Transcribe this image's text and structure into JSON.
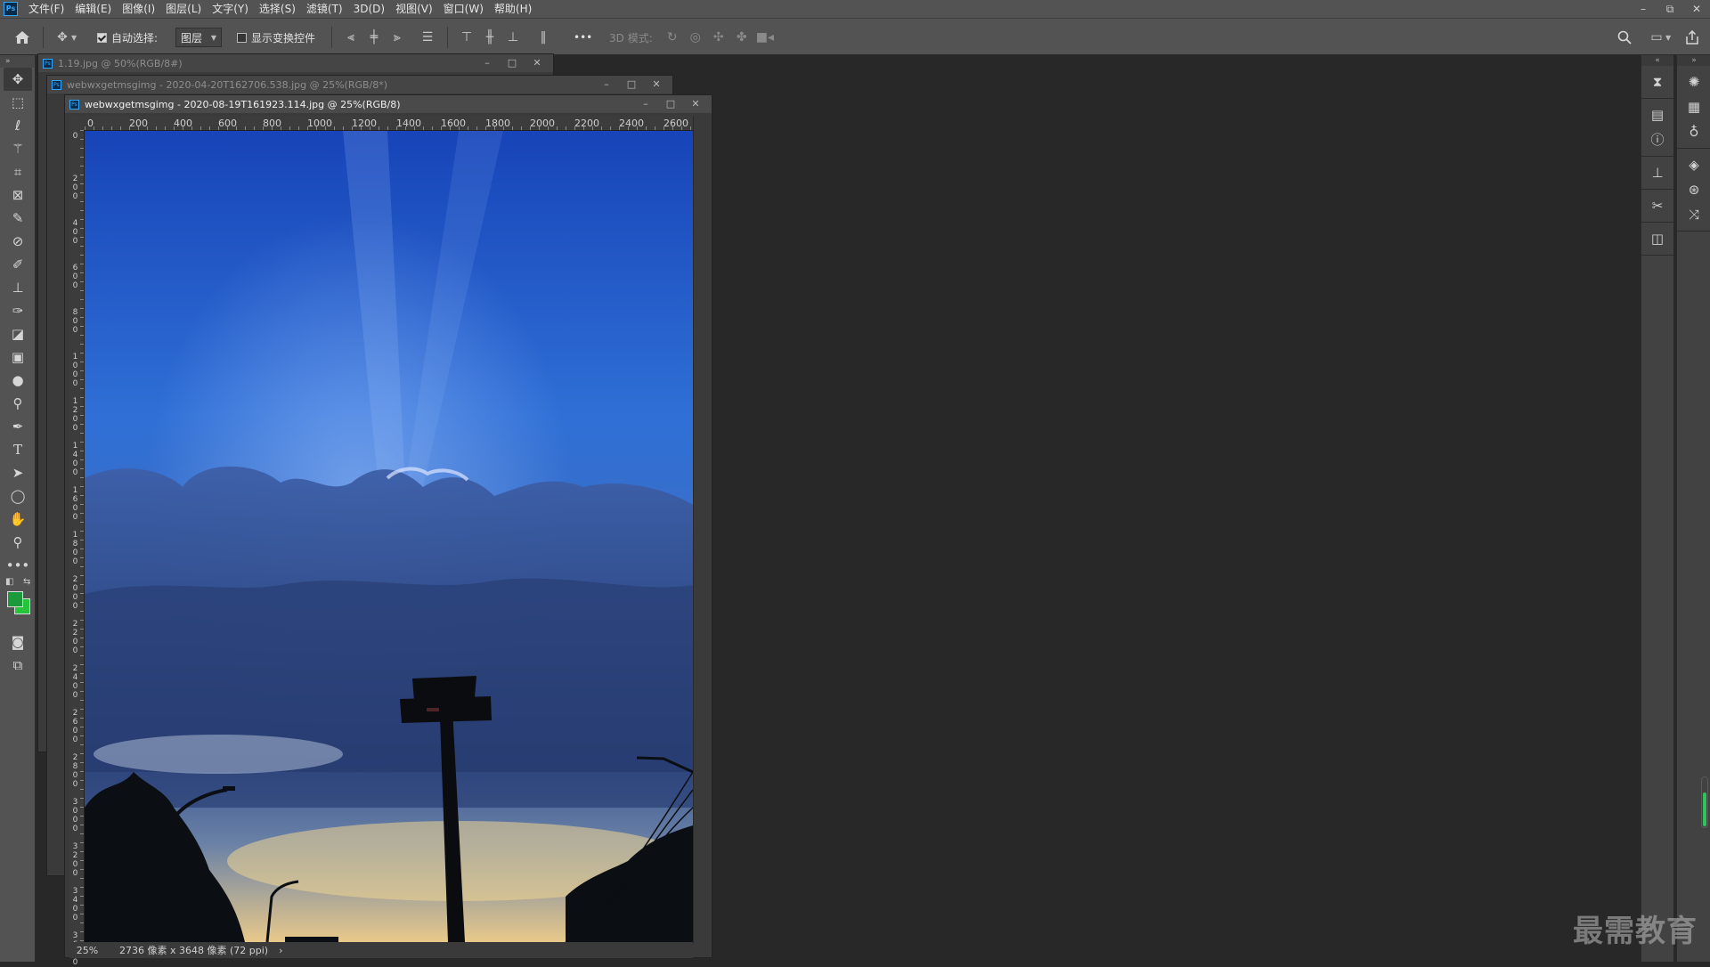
{
  "app": {
    "logo": "Ps"
  },
  "menu": [
    "文件(F)",
    "编辑(E)",
    "图像(I)",
    "图层(L)",
    "文字(Y)",
    "选择(S)",
    "滤镜(T)",
    "3D(D)",
    "视图(V)",
    "窗口(W)",
    "帮助(H)"
  ],
  "window_controls": {
    "minimize": "–",
    "restore": "⧉",
    "close": "✕"
  },
  "options": {
    "auto_select_label": "自动选择:",
    "auto_select_checked": true,
    "layer_dropdown": "图层",
    "show_transform_label": "显示变换控件",
    "show_transform_checked": false,
    "more": "•••",
    "mode_3d_label": "3D 模式:"
  },
  "tools": [
    "move-tool",
    "marquee-tool",
    "lasso-tool",
    "magic-wand-tool",
    "crop-tool",
    "frame-tool",
    "eyedropper-tool",
    "healing-brush-tool",
    "brush-tool",
    "clone-stamp-tool",
    "history-brush-tool",
    "eraser-tool",
    "gradient-tool",
    "blur-tool",
    "dodge-tool",
    "pen-tool",
    "type-tool",
    "path-selection-tool",
    "ellipse-tool",
    "hand-tool",
    "zoom-tool",
    "more-tools"
  ],
  "colors": {
    "foreground": "#1a9a3a",
    "background": "#25c43a"
  },
  "documents": [
    {
      "title": "1.19.jpg @ 50%(RGB/8#)",
      "active": false
    },
    {
      "title": "webwxgetmsgimg - 2020-04-20T162706.538.jpg @ 25%(RGB/8*)",
      "active": false
    },
    {
      "title": "webwxgetmsgimg - 2020-08-19T161923.114.jpg @ 25%(RGB/8)",
      "active": true
    }
  ],
  "ruler_top": [
    "0",
    "200",
    "400",
    "600",
    "800",
    "1000",
    "1200",
    "1400",
    "1600",
    "1800",
    "2000",
    "2200",
    "2400",
    "2600"
  ],
  "ruler_left": [
    "0",
    "200",
    "400",
    "600",
    "800",
    "1000",
    "1200",
    "1400",
    "1600",
    "1800",
    "2000",
    "2200",
    "2400",
    "2600",
    "2800",
    "3000",
    "3200",
    "3400",
    "3600"
  ],
  "status": {
    "zoom": "25%",
    "doc_info": "2736 像素 x 3648 像素 (72 ppi)",
    "arrow": "›"
  },
  "watermark": "最需教育"
}
